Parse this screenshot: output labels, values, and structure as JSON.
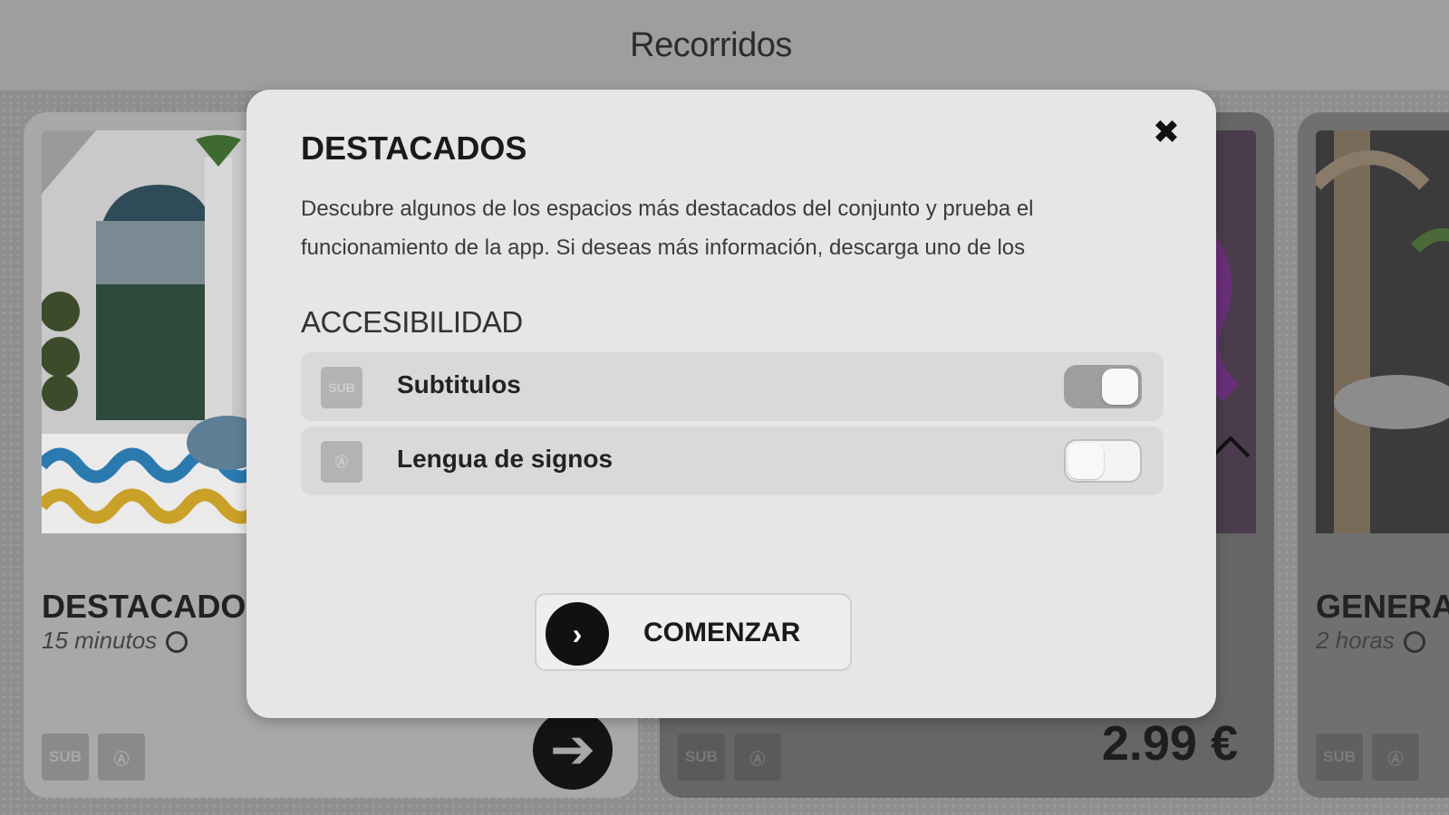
{
  "header": {
    "title": "Recorridos"
  },
  "cards": [
    {
      "name": "DESTACADOS",
      "duration": "15 minutos",
      "badge_sub": "SUB",
      "badge_sign": "Ⓐ"
    },
    {
      "name": "",
      "duration": "",
      "badge_sub": "SUB",
      "badge_sign": "Ⓐ",
      "price": "2.99 €"
    },
    {
      "name": "GENERA",
      "duration": "2 horas",
      "badge_sub": "SUB",
      "badge_sign": "Ⓐ"
    }
  ],
  "modal": {
    "title": "DESTACADOS",
    "close_glyph": "✖",
    "description": "Descubre algunos de los espacios más destacados del conjunto y prueba el funcionamiento de la app. Si deseas más información, descarga uno de los recorridos disponibles.",
    "accessibility_title": "ACCESIBILIDAD",
    "options": [
      {
        "icon": "SUB",
        "label": "Subtitulos",
        "enabled": true
      },
      {
        "icon": "Ⓐ",
        "label": "Lengua de signos",
        "enabled": false
      }
    ],
    "start_label": "COMENZAR",
    "start_glyph": "›"
  },
  "colors": {
    "modal_bg": "#e6e6e6",
    "toggle_on": "#9e9e9e",
    "accent_dark": "#111111"
  },
  "icons": {
    "close": "close-icon",
    "subtitles": "subtitles-icon",
    "sign_language": "sign-language-icon",
    "start": "chevron-right-icon",
    "card_arrow": "arrow-right-icon",
    "clock": "clock-icon"
  }
}
